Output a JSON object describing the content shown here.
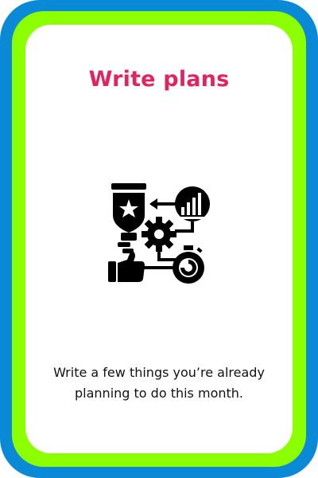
{
  "card": {
    "title": "Write plans",
    "icon": "goal-planning-icon",
    "description": "Write a few things you’re already planning to do this month."
  },
  "colors": {
    "outer_border": "#0a8ad6",
    "inner_border": "#8cff00",
    "title": "#e0245e",
    "text": "#111111",
    "background": "#ffffff"
  }
}
